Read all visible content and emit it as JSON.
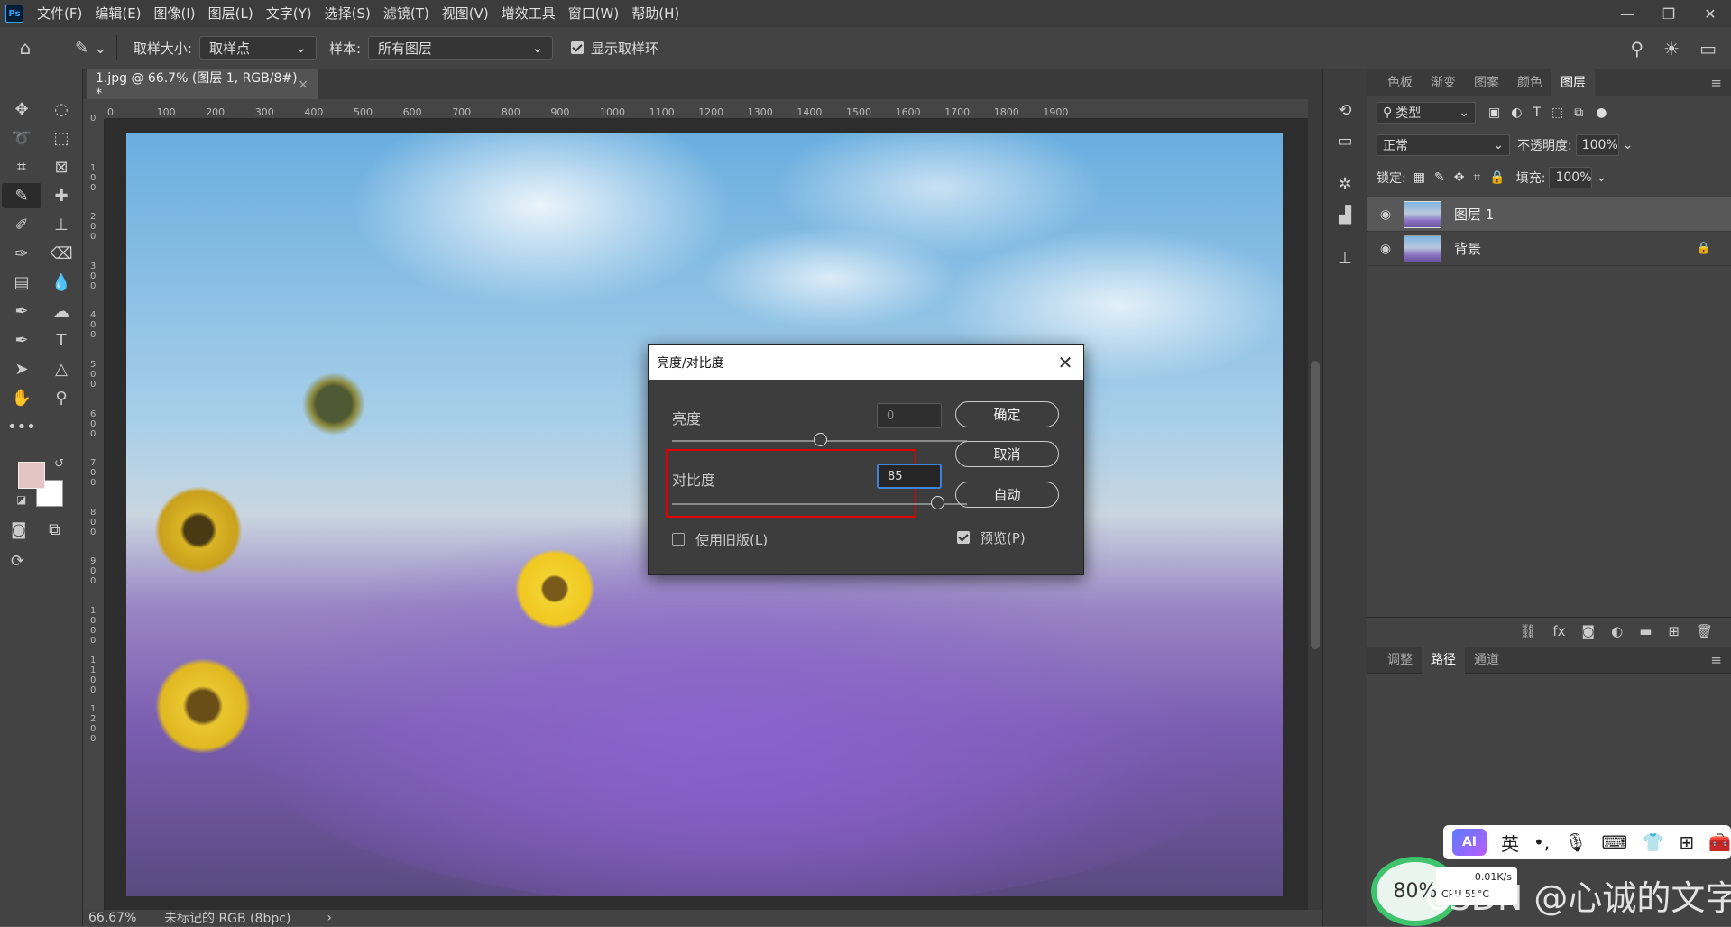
{
  "menubar": {
    "app_logo": "Ps",
    "items": [
      "文件(F)",
      "编辑(E)",
      "图像(I)",
      "图层(L)",
      "文字(Y)",
      "选择(S)",
      "滤镜(T)",
      "视图(V)",
      "增效工具",
      "窗口(W)",
      "帮助(H)"
    ],
    "window_controls": [
      "—",
      "❐",
      "✕"
    ]
  },
  "options": {
    "sample_size_label": "取样大小:",
    "sample_size_value": "取样点",
    "sample_label": "样本:",
    "sample_value": "所有图层",
    "show_ring_label": "显示取样环"
  },
  "document": {
    "tab_title": "1.jpg @ 66.7% (图层 1, RGB/8#) *",
    "zoom": "66.67%",
    "color_profile": "未标记的 RGB (8bpc)"
  },
  "ruler": {
    "h_ticks": [
      "0",
      "100",
      "200",
      "300",
      "400",
      "500",
      "600",
      "700",
      "800",
      "900",
      "1000",
      "1100",
      "1200",
      "1300",
      "1400",
      "1500",
      "1600",
      "1700",
      "1800",
      "1900"
    ],
    "v_ticks": [
      "0",
      "1 0 0",
      "2 0 0",
      "3 0 0",
      "4 0 0",
      "5 0 0",
      "6 0 0",
      "7 0 0",
      "8 0 0",
      "9 0 0",
      "1 0 0 0",
      "1 1 0 0",
      "1 2 0 0"
    ]
  },
  "layers_panel": {
    "tabs": [
      "色板",
      "渐变",
      "图案",
      "颜色",
      "图层"
    ],
    "active_tab": "图层",
    "filter_kind": "类型",
    "blend_mode": "正常",
    "opacity_label": "不透明度:",
    "opacity_value": "100%",
    "lock_label": "锁定:",
    "fill_label": "填充:",
    "fill_value": "100%",
    "layers": [
      {
        "name": "图层 1",
        "selected": true,
        "locked": false
      },
      {
        "name": "背景",
        "selected": false,
        "locked": true
      }
    ]
  },
  "bottom_panel": {
    "tabs": [
      "调整",
      "路径",
      "通道"
    ],
    "active_tab": "路径"
  },
  "dialog": {
    "title": "亮度/对比度",
    "brightness_label": "亮度",
    "brightness_value": "0",
    "brightness_level": 0,
    "contrast_label": "对比度",
    "contrast_value": "85",
    "contrast_level": 85,
    "legacy_label": "使用旧版(L)",
    "legacy_checked": false,
    "preview_label": "预览(P)",
    "preview_checked": true,
    "ok_label": "确定",
    "cancel_label": "取消",
    "auto_label": "自动"
  },
  "overlay": {
    "ime_ai": "AI",
    "ime_lang": "英",
    "cpu_percent": "80%",
    "net_speed": "0.01K/s",
    "cpu_label": "CPU 55°C",
    "watermark": "CSDN @心诚的文字"
  },
  "colors": {
    "foreground": "#e3c6c4",
    "background": "#ffffff",
    "highlight_box": "#e00000",
    "focus_blue": "#3d82d6"
  }
}
